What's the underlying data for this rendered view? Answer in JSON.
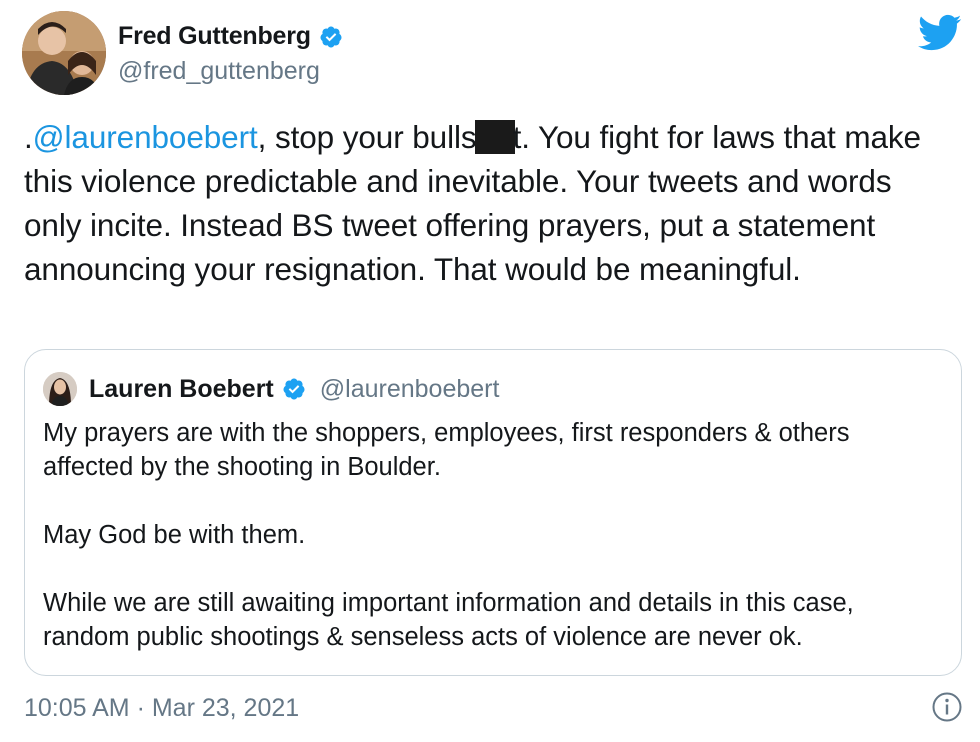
{
  "author": {
    "name": "Fred Guttenberg",
    "handle": "@fred_guttenberg"
  },
  "tweet": {
    "prefix": ".",
    "mention": "@laurenboebert",
    "text_part1": ", stop your bulls",
    "text_part2": "t.  You fight for laws that make this violence predictable and inevitable.  Your tweets and words only incite. Instead BS tweet offering prayers, put a statement announcing your resignation.  That would be meaningful."
  },
  "quoted": {
    "name": "Lauren Boebert",
    "handle": "@laurenboebert",
    "paragraphs": [
      "My prayers are with the shoppers, employees, first responders & others affected by the shooting in Boulder.",
      "May God be with them.",
      "While we are still awaiting important information and details in this case, random public shootings & senseless acts of violence are never ok."
    ]
  },
  "footer": {
    "timestamp": "10:05 AM · Mar 23, 2021"
  },
  "colors": {
    "accent": "#1da1f2",
    "mention": "#1b95e0",
    "secondary_text": "#657786",
    "border": "#ccd6dd"
  },
  "icons": [
    "verified-badge-icon",
    "twitter-bird-icon",
    "info-icon"
  ]
}
